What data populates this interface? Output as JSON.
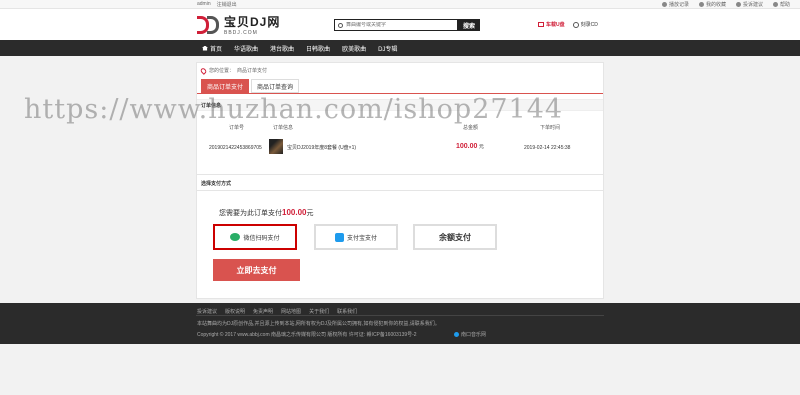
{
  "topbar": {
    "user": "admin",
    "logout": "注销退出",
    "links": [
      "播放记录",
      "我的收藏",
      "投诉建议",
      "帮助"
    ]
  },
  "header": {
    "logo_cn": "宝贝DJ网",
    "logo_en": "BBDJ.COM",
    "search_placeholder": "舞曲编号或关键字",
    "search_button": "搜索",
    "car_u": "车载U盘",
    "burn_cd": "刻录CD"
  },
  "nav": [
    "首页",
    "华语歌曲",
    "港台歌曲",
    "日韩歌曲",
    "欧美歌曲",
    "DJ专辑"
  ],
  "crumb": {
    "prefix": "您的位置：",
    "current": "商品订单支付"
  },
  "tabs": [
    "商品订单支付",
    "商品订单查询"
  ],
  "order": {
    "header": "订单信息",
    "columns": [
      "订单号",
      "订单信息",
      "总金额",
      "下单时间"
    ],
    "row": {
      "order_no": "20190214224538697​05",
      "info": "宝贝DJ2019年度8套餐 (U盘×1)",
      "amount": "100.00",
      "unit": "元",
      "time": "2019-02-14 22:45:38"
    }
  },
  "payment": {
    "header": "选择支付方式",
    "need_prefix": "您需要为此订单支付",
    "need_amount": "100.00",
    "need_unit": "元",
    "options": [
      "微信扫码支付",
      "支付宝支付",
      "余额支付"
    ],
    "pay_button": "立即去支付"
  },
  "footer": {
    "links": [
      "投诉建议",
      "版权说明",
      "免责声明",
      "网站地图",
      "关于我们",
      "联系我们"
    ],
    "notice": "本站舞曲均为DJ原创作品,并且源上传到本站,网所有权为DJ及所属公司拥有,如有侵犯到你的权益,请联系我们。",
    "copyright": "Copyright © 2017 www.abbj.com 南昌璃之乐传媒有限公司 版权所有  许可证: 赣ICP备16003139号-2",
    "right": "南口音乐网"
  },
  "watermark": "https://www.huzhan.com/ishop27144"
}
